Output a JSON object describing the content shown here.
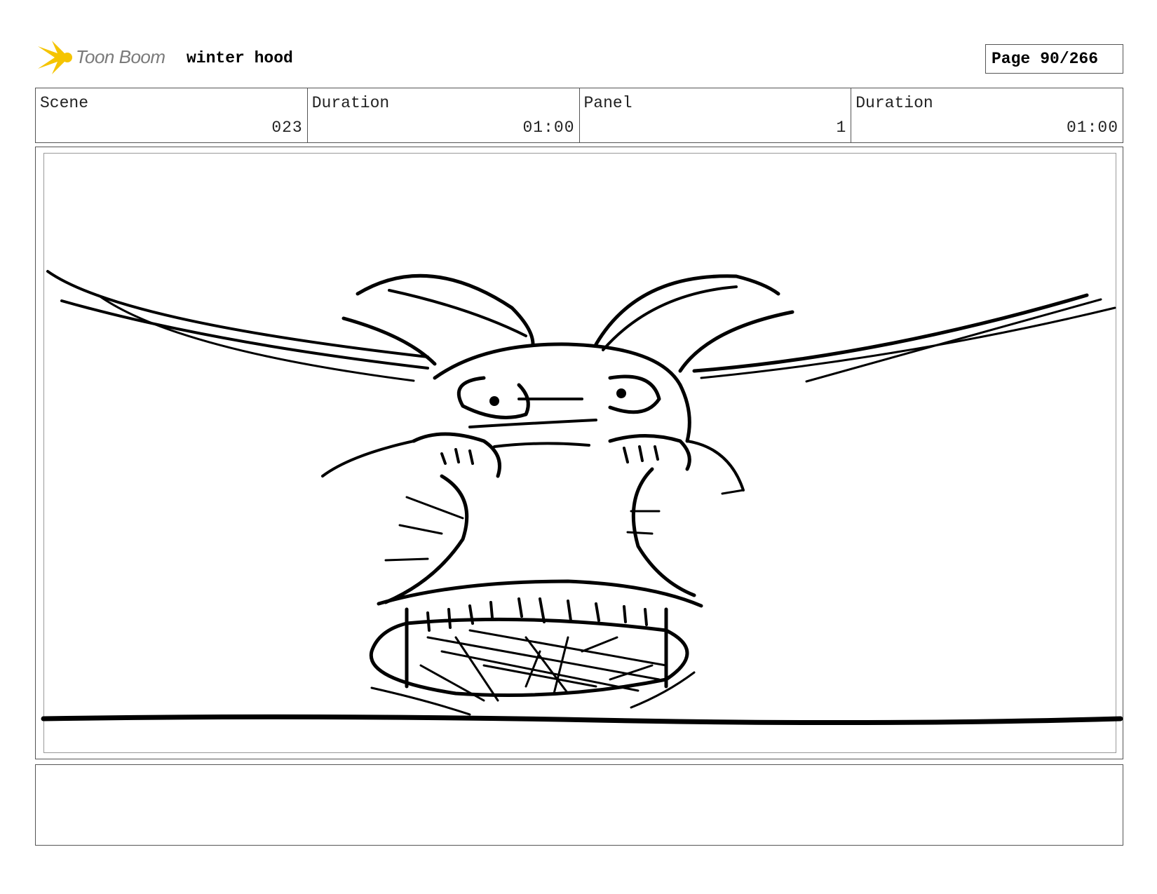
{
  "header": {
    "logo_text": "Toon Boom",
    "project_title": "winter hood",
    "page_label": "Page",
    "page_number": "90/266"
  },
  "info": {
    "scene_label": "Scene",
    "scene_value": "023",
    "scene_duration_label": "Duration",
    "scene_duration_value": "01:00",
    "panel_label": "Panel",
    "panel_value": "1",
    "panel_duration_label": "Duration",
    "panel_duration_value": "01:00"
  },
  "notes": {
    "text": ""
  },
  "colors": {
    "logo_star": "#f5c400",
    "logo_text": "#7a7a7a",
    "border": "#555555"
  }
}
